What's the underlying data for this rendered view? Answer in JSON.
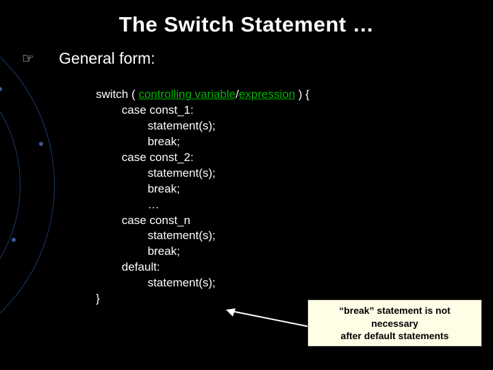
{
  "title": "The Switch Statement …",
  "subtitle": "General form:",
  "code": {
    "l1a": "switch ( ",
    "l1_ctrl1": "controlling variable",
    "l1_sep": "/",
    "l1_ctrl2": "expression",
    "l1b": " ) {",
    "l2": "        case const_1:",
    "l3": "                statement(s);",
    "l4": "                break;",
    "l5": "        case const_2:",
    "l6": "                statement(s);",
    "l7": "                break;",
    "l8": "                …",
    "l9": "        case const_n",
    "l10": "                statement(s);",
    "l11": "                break;",
    "l12": "        default:",
    "l13": "                statement(s);",
    "l14": "}"
  },
  "callout_line1": "“break” statement is not necessary",
  "callout_line2": "after default statements"
}
